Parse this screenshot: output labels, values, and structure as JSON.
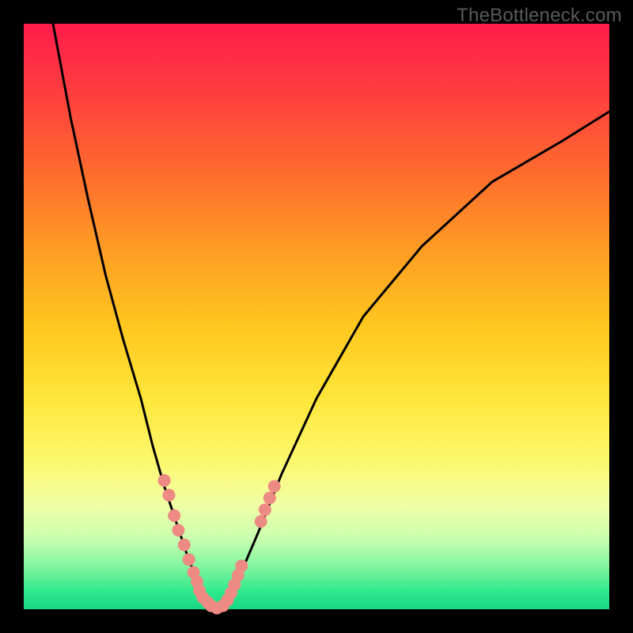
{
  "watermark": "TheBottleneck.com",
  "colors": {
    "watermark_text": "#5a5a5a",
    "curve_stroke": "#000000",
    "dot_fill": "#ed8a83",
    "gradient_top": "#ff1c4b",
    "gradient_bottom": "#17d884",
    "frame": "#000000"
  },
  "chart_data": {
    "type": "line",
    "title": "",
    "xlabel": "",
    "ylabel": "",
    "xlim": [
      0,
      100
    ],
    "ylim": [
      0,
      100
    ],
    "grid": false,
    "legend": false,
    "annotations": [
      "TheBottleneck.com"
    ],
    "series": [
      {
        "name": "left-curve",
        "x": [
          5,
          8,
          11,
          14,
          17,
          20,
          22,
          24,
          26,
          28,
          30,
          31,
          32,
          33
        ],
        "y": [
          100,
          84,
          70,
          57,
          46,
          36,
          28,
          21,
          15,
          9,
          4,
          2,
          0.8,
          0.2
        ]
      },
      {
        "name": "right-curve",
        "x": [
          33,
          35,
          37,
          40,
          44,
          50,
          58,
          68,
          80,
          92,
          100
        ],
        "y": [
          0.2,
          2,
          6,
          13,
          23,
          36,
          50,
          62,
          73,
          80,
          85
        ]
      }
    ],
    "dots": [
      {
        "x": 24.0,
        "y": 22.0
      },
      {
        "x": 24.8,
        "y": 19.5
      },
      {
        "x": 25.7,
        "y": 16.0
      },
      {
        "x": 26.4,
        "y": 13.5
      },
      {
        "x": 27.4,
        "y": 11.0
      },
      {
        "x": 28.2,
        "y": 8.5
      },
      {
        "x": 29.0,
        "y": 6.3
      },
      {
        "x": 29.6,
        "y": 4.7
      },
      {
        "x": 30.0,
        "y": 3.2
      },
      {
        "x": 30.6,
        "y": 2.0
      },
      {
        "x": 31.4,
        "y": 1.2
      },
      {
        "x": 32.0,
        "y": 0.6
      },
      {
        "x": 33.0,
        "y": 0.2
      },
      {
        "x": 34.0,
        "y": 0.6
      },
      {
        "x": 34.8,
        "y": 1.6
      },
      {
        "x": 35.4,
        "y": 2.8
      },
      {
        "x": 36.0,
        "y": 4.2
      },
      {
        "x": 36.6,
        "y": 5.8
      },
      {
        "x": 37.2,
        "y": 7.4
      },
      {
        "x": 40.5,
        "y": 15.0
      },
      {
        "x": 41.2,
        "y": 17.0
      },
      {
        "x": 42.0,
        "y": 19.0
      },
      {
        "x": 42.8,
        "y": 21.0
      }
    ]
  }
}
